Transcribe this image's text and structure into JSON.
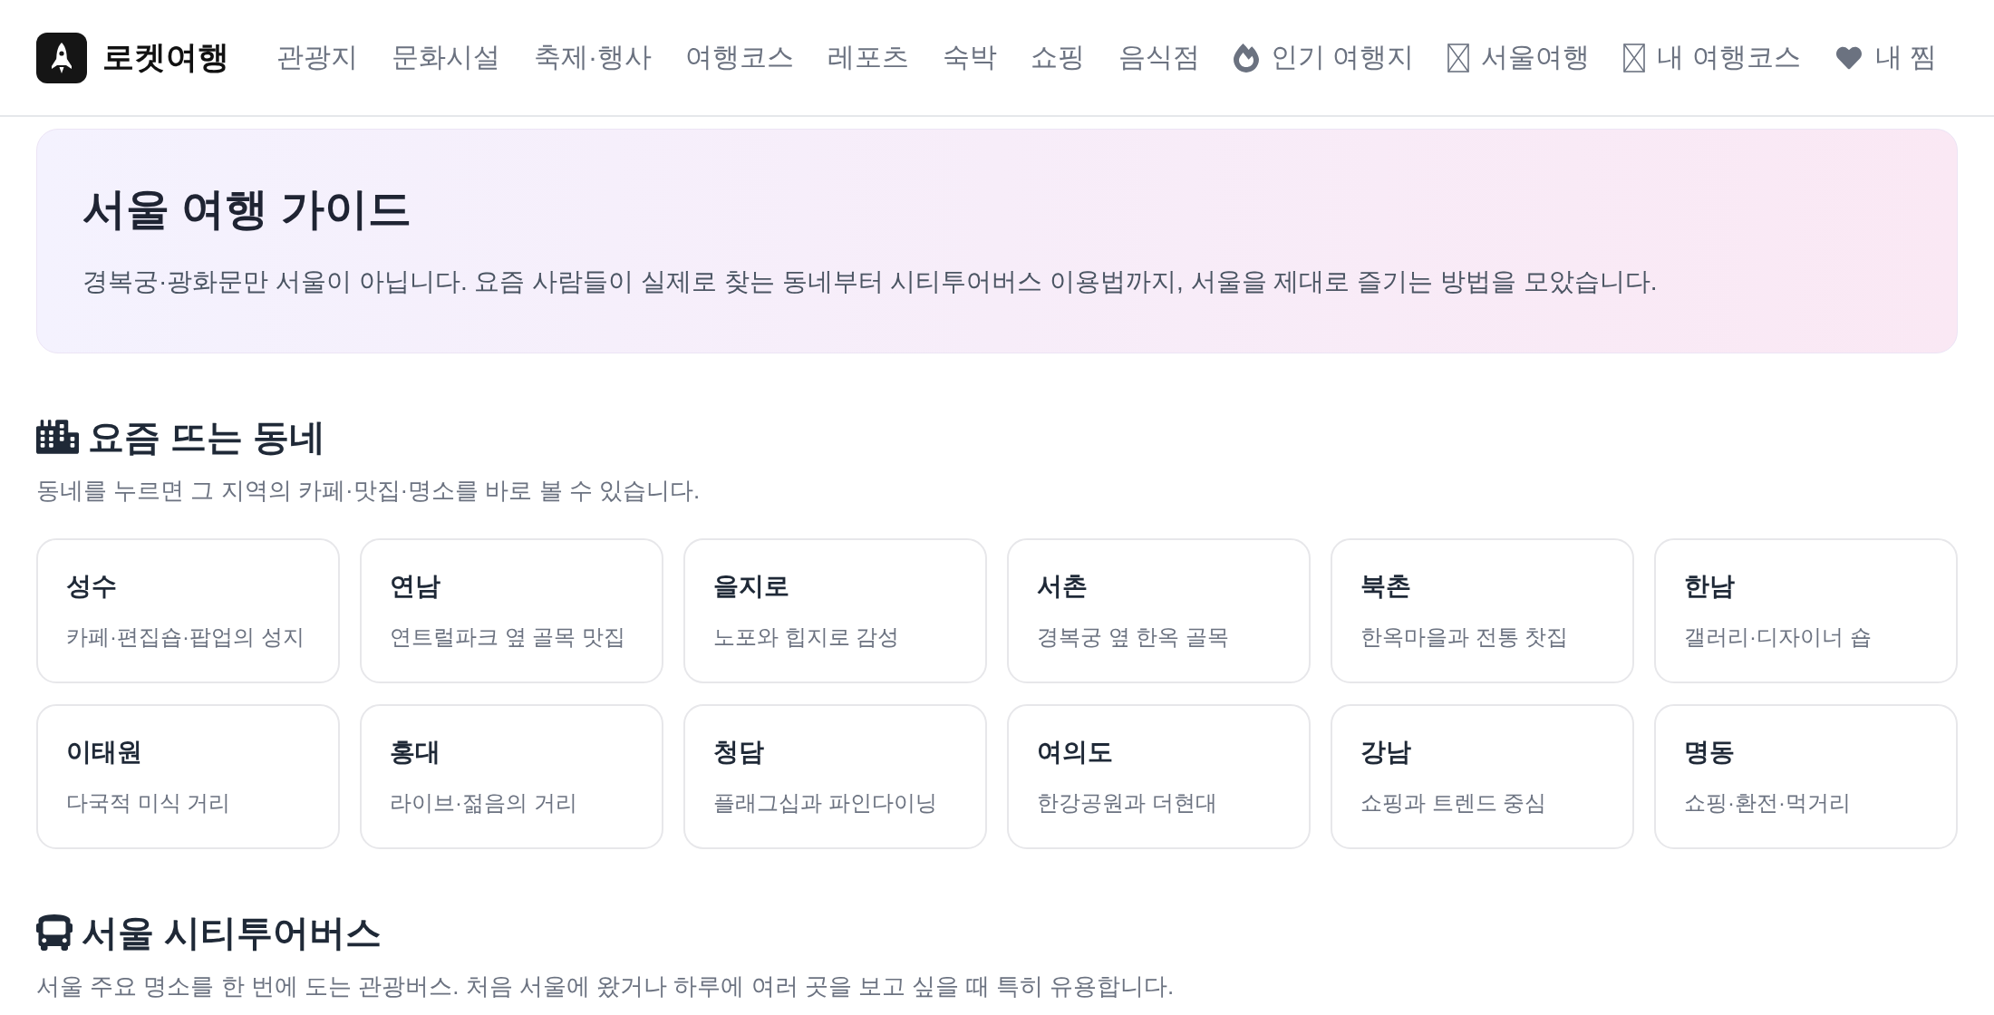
{
  "header": {
    "brand": "로켓여행",
    "nav": [
      {
        "label": "관광지",
        "kind": "plain"
      },
      {
        "label": "문화시설",
        "kind": "plain"
      },
      {
        "label": "축제·행사",
        "kind": "plain"
      },
      {
        "label": "여행코스",
        "kind": "plain"
      },
      {
        "label": "레포츠",
        "kind": "plain"
      },
      {
        "label": "숙박",
        "kind": "plain"
      },
      {
        "label": "쇼핑",
        "kind": "plain"
      },
      {
        "label": "음식점",
        "kind": "plain"
      },
      {
        "label": "인기 여행지",
        "kind": "fire"
      },
      {
        "label": "서울여행",
        "kind": "box"
      },
      {
        "label": "내 여행코스",
        "kind": "box"
      },
      {
        "label": "내 찜",
        "kind": "heart"
      }
    ]
  },
  "hero": {
    "title": "서울 여행 가이드",
    "text": "경복궁·광화문만 서울이 아닙니다. 요즘 사람들이 실제로 찾는 동네부터 시티투어버스 이용법까지, 서울을 제대로 즐기는 방법을 모았습니다."
  },
  "sections": [
    {
      "kind": "city",
      "title": "요즘 뜨는 동네",
      "subtitle": "동네를 누르면 그 지역의 카페·맛집·명소를 바로 볼 수 있습니다.",
      "neighborhoods": [
        {
          "name": "성수",
          "description": "카페·편집숍·팝업의 성지"
        },
        {
          "name": "연남",
          "description": "연트럴파크 옆 골목 맛집"
        },
        {
          "name": "을지로",
          "description": "노포와 힙지로 감성"
        },
        {
          "name": "서촌",
          "description": "경복궁 옆 한옥 골목"
        },
        {
          "name": "북촌",
          "description": "한옥마을과 전통 찻집"
        },
        {
          "name": "한남",
          "description": "갤러리·디자이너 숍"
        },
        {
          "name": "이태원",
          "description": "다국적 미식 거리"
        },
        {
          "name": "홍대",
          "description": "라이브·젊음의 거리"
        },
        {
          "name": "청담",
          "description": "플래그십과 파인다이닝"
        },
        {
          "name": "여의도",
          "description": "한강공원과 더현대"
        },
        {
          "name": "강남",
          "description": "쇼핑과 트렌드 중심"
        },
        {
          "name": "명동",
          "description": "쇼핑·환전·먹거리"
        }
      ]
    },
    {
      "kind": "bus",
      "title": "서울 시티투어버스",
      "subtitle": "서울 주요 명소를 한 번에 도는 관광버스. 처음 서울에 왔거나 하루에 여러 곳을 보고 싶을 때 특히 유용합니다."
    }
  ]
}
